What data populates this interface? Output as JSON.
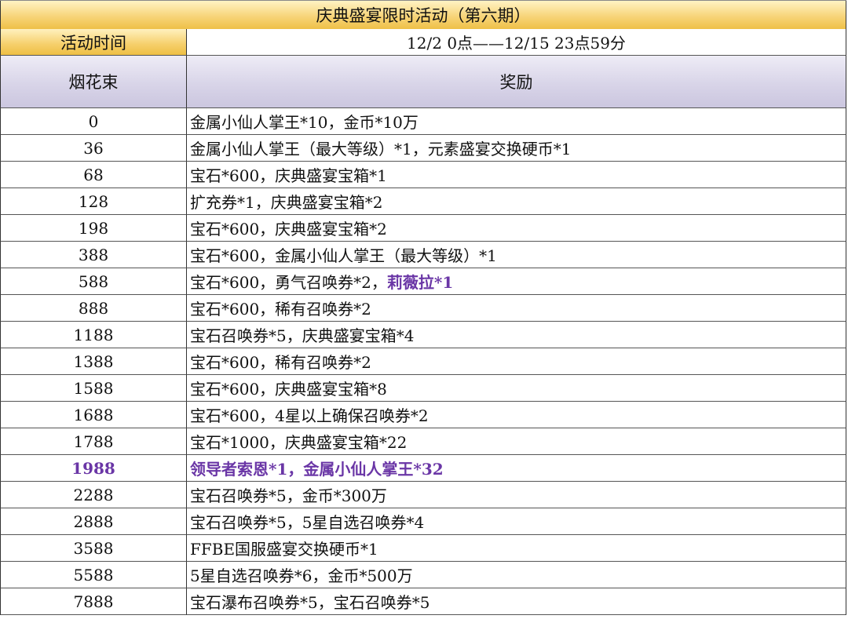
{
  "title": "庆典盛宴限时活动（第六期）",
  "time_label": "活动时间",
  "time_value": "12/2 0点——12/15 23点59分",
  "headers": {
    "col1": "烟花束",
    "col2": "奖励"
  },
  "highlight_color": "#6a36a6",
  "rows": [
    {
      "count": "0",
      "reward": "金属小仙人掌王*10，金币*10万"
    },
    {
      "count": "36",
      "reward": "金属小仙人掌王（最大等级）*1，元素盛宴交换硬币*1"
    },
    {
      "count": "68",
      "reward": "宝石*600，庆典盛宴宝箱*1"
    },
    {
      "count": "128",
      "reward": "扩充券*1，庆典盛宴宝箱*2"
    },
    {
      "count": "198",
      "reward": "宝石*600，庆典盛宴宝箱*2"
    },
    {
      "count": "388",
      "reward": "宝石*600，金属小仙人掌王（最大等级）*1"
    },
    {
      "count": "588",
      "reward": "宝石*600，勇气召唤券*2，",
      "reward_highlight": "莉薇拉*1"
    },
    {
      "count": "888",
      "reward": "宝石*600，稀有召唤券*2"
    },
    {
      "count": "1188",
      "reward": "宝石召唤券*5，庆典盛宴宝箱*4"
    },
    {
      "count": "1388",
      "reward": "宝石*600，稀有召唤券*2"
    },
    {
      "count": "1588",
      "reward": "宝石*600，庆典盛宴宝箱*8"
    },
    {
      "count": "1688",
      "reward": "宝石*600，4星以上确保召唤券*2"
    },
    {
      "count": "1788",
      "reward": "宝石*1000，庆典盛宴宝箱*22"
    },
    {
      "count": "1988",
      "reward": "领导者索恩*1，金属小仙人掌王*32",
      "highlight_row": true
    },
    {
      "count": "2288",
      "reward": "宝石召唤券*5，金币*300万"
    },
    {
      "count": "2888",
      "reward": "宝石召唤券*5，5星自选召唤券*4"
    },
    {
      "count": "3588",
      "reward": "FFBE国服盛宴交换硬币*1"
    },
    {
      "count": "5588",
      "reward": "5星自选召唤券*6，金币*500万"
    },
    {
      "count": "7888",
      "reward": "宝石瀑布召唤券*5，宝石召唤券*5"
    }
  ]
}
